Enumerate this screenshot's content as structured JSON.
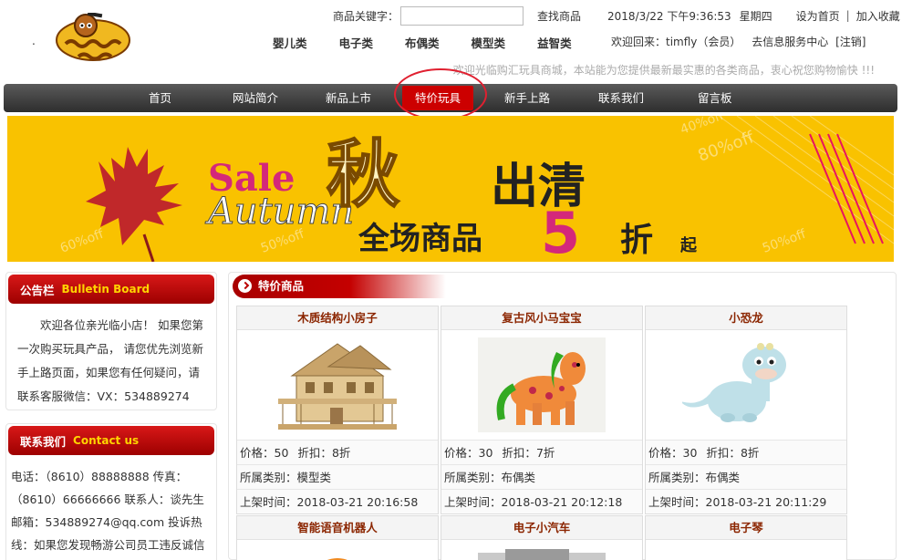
{
  "header": {
    "keyword_label": "商品关键字：",
    "keyword_value": "",
    "search_link": "查找商品",
    "datetime": "2018/3/22 下午9:36:53",
    "weekday": "星期四",
    "set_home": "设为首页",
    "separator": "|",
    "bookmark": "加入收藏",
    "categories": [
      "婴儿类",
      "电子类",
      "布偶类",
      "模型类",
      "益智类"
    ],
    "user_greeting": "欢迎回来：timfly（会员）",
    "service_center": "去信息服务中心",
    "logout": "[注销]",
    "welcome_line": "欢迎光临购汇玩具商城，本站能为您提供最新最实惠的各类商品，衷心祝您购物愉快 !!!",
    "logo_dot": "."
  },
  "nav": {
    "items": [
      "首页",
      "网站简介",
      "新品上市",
      "特价玩具",
      "新手上路",
      "联系我们",
      "留言板"
    ],
    "active_index": 3
  },
  "banner": {
    "sale": "Sale",
    "autumn": "Autumn",
    "qiu": "秋",
    "clearance": "出清",
    "all_items": "全场商品",
    "discount": "5",
    "zhe": "折",
    "qi": "起",
    "off_tags": [
      "40%off",
      "80%off",
      "50%off",
      "50%off",
      "60%off"
    ]
  },
  "bulletin": {
    "title_cn": "公告栏",
    "title_en": "Bulletin Board",
    "text": "欢迎各位亲光临小店！ 如果您第一次购买玩具产品， 请您优先浏览新手上路页面，如果您有任何疑问，请联系客服微信：VX：534889274"
  },
  "contact": {
    "title_cn": "联系我们",
    "title_en": "Contact us",
    "text": "电话：（8610）88888888 传真：（8610）66666666 联系人：谈先生 邮箱：534889274@qq.com 投诉热线：如果您发现畅游公司员工违反诚信正"
  },
  "products": {
    "section_title": "特价商品",
    "price_label": "价格：",
    "discount_label": "折扣：",
    "zhe_unit": "折",
    "category_label": "所属类别：",
    "time_label": "上架时间：",
    "items": [
      {
        "name": "木质结构小房子",
        "price": "50",
        "discount": "8",
        "category": "模型类",
        "time": "2018-03-21 20:16:58"
      },
      {
        "name": "复古风小马宝宝",
        "price": "30",
        "discount": "7",
        "category": "布偶类",
        "time": "2018-03-21 20:12:18"
      },
      {
        "name": "小恐龙",
        "price": "30",
        "discount": "8",
        "category": "布偶类",
        "time": "2018-03-21 20:11:29"
      },
      {
        "name": "智能语音机器人"
      },
      {
        "name": "电子小汽车"
      },
      {
        "name": "电子琴"
      }
    ]
  },
  "colors": {
    "nav_active": "#cc0000",
    "highlight_circle": "#e02030",
    "banner_bg": "#f9c200",
    "product_name": "#8b2500"
  }
}
